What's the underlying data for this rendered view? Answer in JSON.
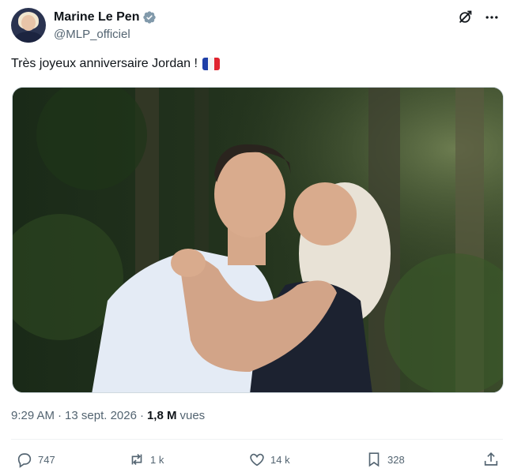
{
  "author": {
    "display_name": "Marine Le Pen",
    "handle": "@MLP_officiel",
    "verified": true,
    "verified_color": "#829aab"
  },
  "tweet": {
    "text": "Très joyeux anniversaire Jordan !",
    "emoji": "french-flag-emoji"
  },
  "meta": {
    "time": "9:29 AM",
    "separator": "·",
    "date": "13 sept. 2026",
    "views_count": "1,8 M",
    "views_label": "vues"
  },
  "actions": {
    "replies": "747",
    "retweets": "1 k",
    "likes": "14 k",
    "bookmarks": "328"
  },
  "colors": {
    "text_primary": "#0f1419",
    "text_secondary": "#536471",
    "divider": "#eff3f4"
  }
}
